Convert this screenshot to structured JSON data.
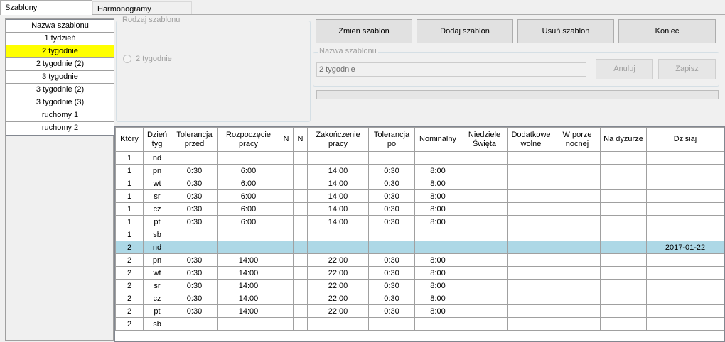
{
  "tabs": [
    {
      "label": "Szablony",
      "active": true
    },
    {
      "label": "Harmonogramy",
      "active": false
    }
  ],
  "template_list": {
    "header": "Nazwa szablonu",
    "items": [
      {
        "label": "1 tydzień",
        "selected": false
      },
      {
        "label": "2 tygodnie",
        "selected": true
      },
      {
        "label": "2 tygodnie (2)",
        "selected": false
      },
      {
        "label": "3 tygodnie",
        "selected": false
      },
      {
        "label": "3 tygodnie (2)",
        "selected": false
      },
      {
        "label": "3 tygodnie (3)",
        "selected": false
      },
      {
        "label": "ruchomy 1",
        "selected": false
      },
      {
        "label": "ruchomy 2",
        "selected": false
      }
    ]
  },
  "template_type": {
    "legend": "Rodzaj szablonu",
    "option": "2 tygodnie"
  },
  "actions": {
    "change": "Zmień szablon",
    "add": "Dodaj szablon",
    "delete": "Usuń szablon",
    "end": "Koniec"
  },
  "name_group": {
    "legend": "Nazwa szablonu",
    "value": "2 tygodnie",
    "cancel": "Anuluj",
    "save": "Zapisz"
  },
  "colors": {
    "selected_item": "#ffff00",
    "highlighted_row": "#add8e6"
  },
  "grid": {
    "columns": [
      "Który",
      "Dzień tyg",
      "Tolerancja przed",
      "Rozpoczęcie pracy",
      "N",
      "N",
      "Zakończenie pracy",
      "Tolerancja po",
      "Nominalny",
      "Niedziele Święta",
      "Dodatkowe wolne",
      "W porze nocnej",
      "Na dyżurze",
      "Dzisiaj"
    ],
    "rows": [
      {
        "cells": [
          "1",
          "nd",
          "",
          "",
          "",
          "",
          "",
          "",
          "",
          "",
          "",
          "",
          "",
          ""
        ]
      },
      {
        "cells": [
          "1",
          "pn",
          "0:30",
          "6:00",
          "",
          "",
          "14:00",
          "0:30",
          "8:00",
          "",
          "",
          "",
          "",
          ""
        ]
      },
      {
        "cells": [
          "1",
          "wt",
          "0:30",
          "6:00",
          "",
          "",
          "14:00",
          "0:30",
          "8:00",
          "",
          "",
          "",
          "",
          ""
        ]
      },
      {
        "cells": [
          "1",
          "sr",
          "0:30",
          "6:00",
          "",
          "",
          "14:00",
          "0:30",
          "8:00",
          "",
          "",
          "",
          "",
          ""
        ]
      },
      {
        "cells": [
          "1",
          "cz",
          "0:30",
          "6:00",
          "",
          "",
          "14:00",
          "0:30",
          "8:00",
          "",
          "",
          "",
          "",
          ""
        ]
      },
      {
        "cells": [
          "1",
          "pt",
          "0:30",
          "6:00",
          "",
          "",
          "14:00",
          "0:30",
          "8:00",
          "",
          "",
          "",
          "",
          ""
        ]
      },
      {
        "cells": [
          "1",
          "sb",
          "",
          "",
          "",
          "",
          "",
          "",
          "",
          "",
          "",
          "",
          "",
          ""
        ]
      },
      {
        "cells": [
          "2",
          "nd",
          "",
          "",
          "",
          "",
          "",
          "",
          "",
          "",
          "",
          "",
          "",
          "2017-01-22"
        ],
        "highlight": true
      },
      {
        "cells": [
          "2",
          "pn",
          "0:30",
          "14:00",
          "",
          "",
          "22:00",
          "0:30",
          "8:00",
          "",
          "",
          "",
          "",
          ""
        ]
      },
      {
        "cells": [
          "2",
          "wt",
          "0:30",
          "14:00",
          "",
          "",
          "22:00",
          "0:30",
          "8:00",
          "",
          "",
          "",
          "",
          ""
        ]
      },
      {
        "cells": [
          "2",
          "sr",
          "0:30",
          "14:00",
          "",
          "",
          "22:00",
          "0:30",
          "8:00",
          "",
          "",
          "",
          "",
          ""
        ]
      },
      {
        "cells": [
          "2",
          "cz",
          "0:30",
          "14:00",
          "",
          "",
          "22:00",
          "0:30",
          "8:00",
          "",
          "",
          "",
          "",
          ""
        ]
      },
      {
        "cells": [
          "2",
          "pt",
          "0:30",
          "14:00",
          "",
          "",
          "22:00",
          "0:30",
          "8:00",
          "",
          "",
          "",
          "",
          ""
        ]
      },
      {
        "cells": [
          "2",
          "sb",
          "",
          "",
          "",
          "",
          "",
          "",
          "",
          "",
          "",
          "",
          "",
          ""
        ]
      }
    ]
  }
}
